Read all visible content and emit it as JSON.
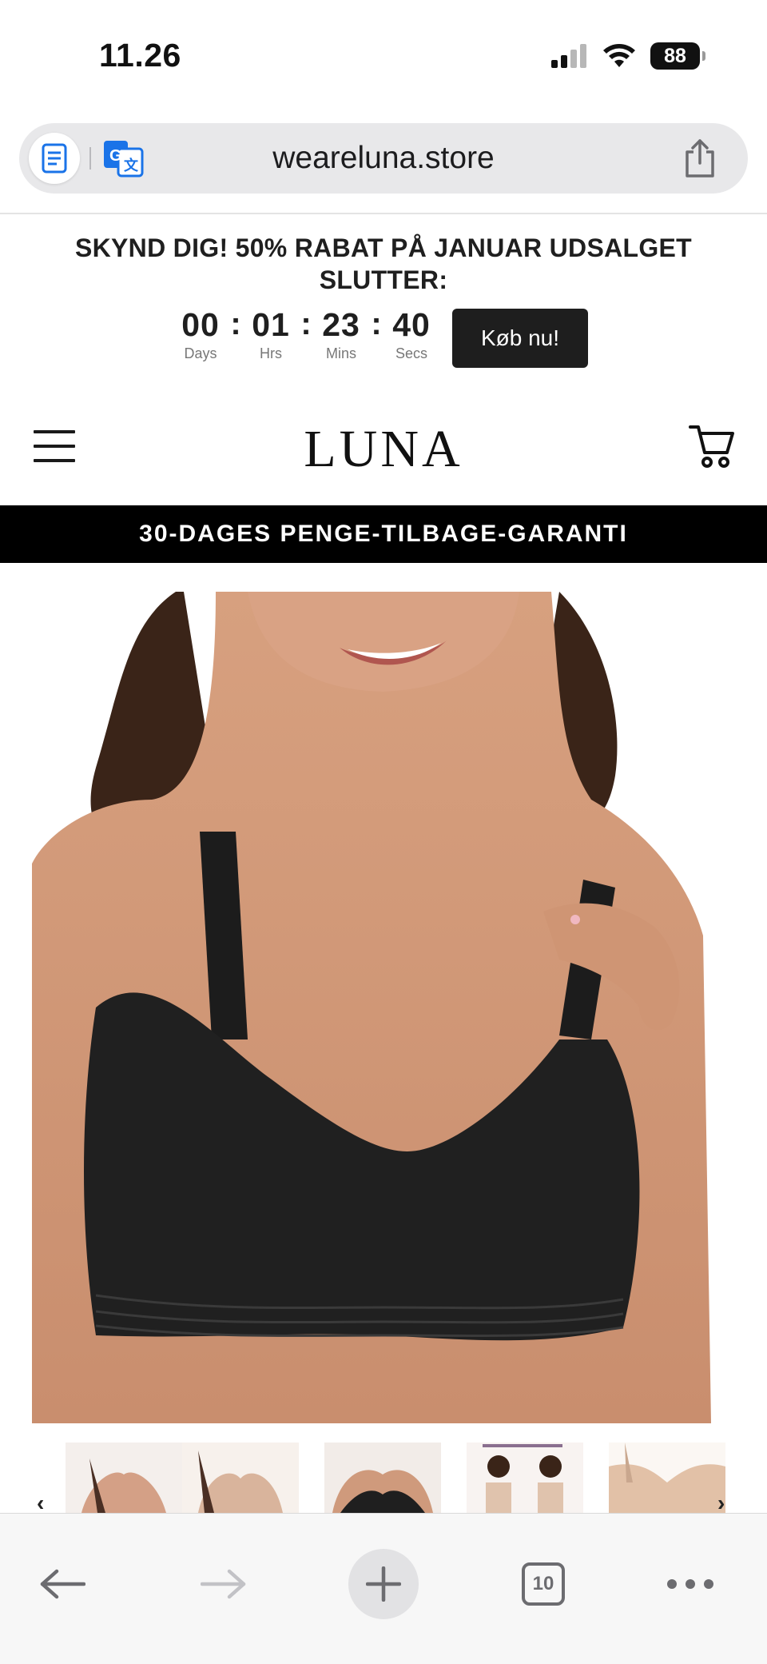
{
  "status_bar": {
    "time": "11.26",
    "battery": "88"
  },
  "address_bar": {
    "url": "weareluna.store"
  },
  "announcement": {
    "text": "SKYND DIG! 50% RABAT PÅ JANUAR UDSALGET SLUTTER:",
    "countdown": {
      "days": "00",
      "days_label": "Days",
      "hours": "01",
      "hours_label": "Hrs",
      "minutes": "23",
      "minutes_label": "Mins",
      "seconds": "40",
      "seconds_label": "Secs"
    },
    "buy_label": "Køb nu!"
  },
  "header": {
    "logo": "LUNA"
  },
  "guarantee": {
    "text": "30-DAGES PENGE-TILBAGE-GARANTI"
  },
  "gallery": {
    "prev_arrow": "‹",
    "next_arrow": "›",
    "thumbnail_count": 5
  },
  "bottom_toolbar": {
    "tab_count": "10"
  },
  "colors": {
    "accent_dark": "#1e1e1e",
    "guarantee_bg": "#000000",
    "address_bg": "#e8e8ea",
    "link_blue": "#1a73e8"
  }
}
